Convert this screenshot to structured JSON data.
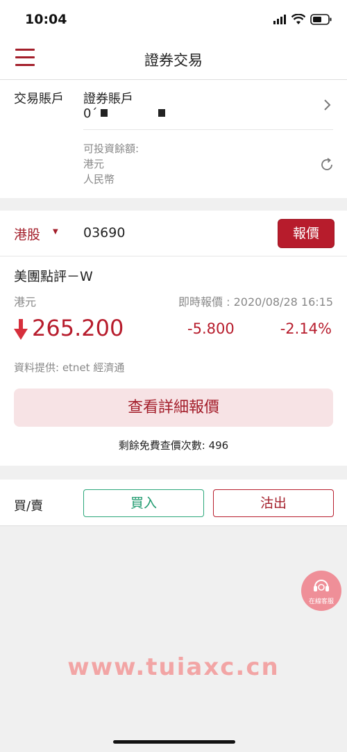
{
  "status_bar": {
    "time": "10:04"
  },
  "nav": {
    "title": "證券交易"
  },
  "account": {
    "label": "交易賬戶",
    "type": "證券賬戶",
    "number_prefix": "0´",
    "available_label": "可投資餘額:",
    "hkd_label": "港元",
    "rmb_label": "人民幣"
  },
  "stock": {
    "market": "港股",
    "code": "03690",
    "quote_button": "報價"
  },
  "quote": {
    "name": "美團點評－W",
    "currency": "港元",
    "quote_time": "即時報價 : 2020/08/28 16:15",
    "price": "265.200",
    "change": "-5.800",
    "change_pct": "-2.14%",
    "provider": "資料提供: etnet 經濟通",
    "detail_button": "查看詳細報價",
    "free_count": "剩餘免費查價次數: 496"
  },
  "trade": {
    "label": "買/賣",
    "buy": "買入",
    "sell": "沽出"
  },
  "service": {
    "label": "在線客服"
  },
  "watermark": "www.tuiaxc.cn",
  "colors": {
    "accent": "#a31e2a",
    "buy": "#1e9a6e",
    "down": "#b71c2c"
  }
}
